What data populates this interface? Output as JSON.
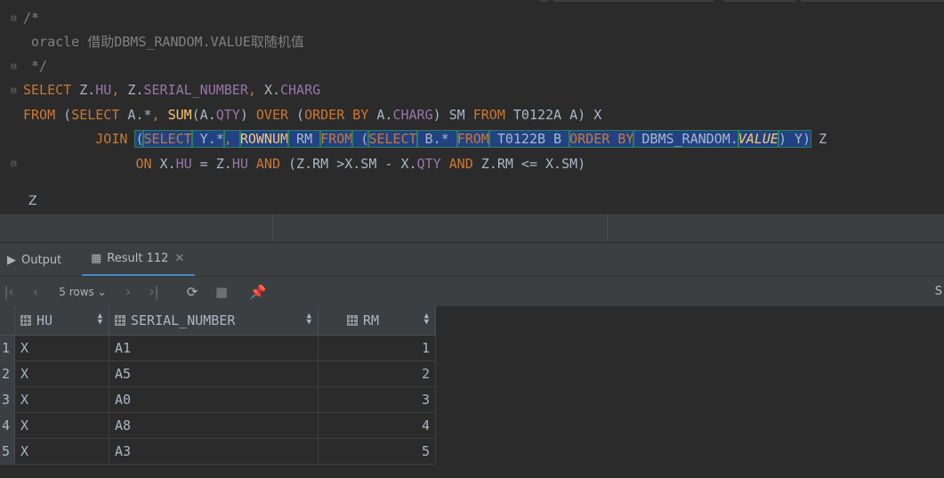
{
  "editor": {
    "lines": [
      {
        "parts": [
          {
            "t": "/*",
            "c": "cm"
          }
        ]
      },
      {
        "parts": [
          {
            "t": " oracle 借助DBMS_RANDOM.VALUE取随机值",
            "c": "cm"
          }
        ]
      },
      {
        "parts": [
          {
            "t": " */",
            "c": "cm"
          }
        ]
      },
      {
        "parts": [
          {
            "t": "SELECT",
            "c": "kw"
          },
          {
            "t": " Z.",
            "c": ""
          },
          {
            "t": "HU",
            "c": "fld"
          },
          {
            "t": ", ",
            "c": "kw"
          },
          {
            "t": "Z.",
            "c": ""
          },
          {
            "t": "SERIAL_NUMBER",
            "c": "fld"
          },
          {
            "t": ", ",
            "c": "kw"
          },
          {
            "t": "X.",
            "c": ""
          },
          {
            "t": "CHARG",
            "c": "fld"
          }
        ]
      },
      {
        "parts": [
          {
            "t": "FROM",
            "c": "kw"
          },
          {
            "t": " (",
            "c": ""
          },
          {
            "t": "SELECT",
            "c": "kw"
          },
          {
            "t": " A.*",
            "c": ""
          },
          {
            "t": ", ",
            "c": "kw"
          },
          {
            "t": "SUM",
            "c": "fn"
          },
          {
            "t": "(A.",
            "c": ""
          },
          {
            "t": "QTY",
            "c": "fld"
          },
          {
            "t": ") ",
            "c": ""
          },
          {
            "t": "OVER",
            "c": "kw"
          },
          {
            "t": " (",
            "c": ""
          },
          {
            "t": "ORDER BY",
            "c": "kw"
          },
          {
            "t": " A.",
            "c": ""
          },
          {
            "t": "CHARG",
            "c": "fld"
          },
          {
            "t": ") SM ",
            "c": ""
          },
          {
            "t": "FROM",
            "c": "kw"
          },
          {
            "t": " T0122A A) X",
            "c": ""
          }
        ]
      },
      {
        "parts": [
          {
            "t": "         ",
            "c": ""
          },
          {
            "t": "JOIN",
            "c": "kw"
          },
          {
            "t": " ",
            "c": ""
          },
          {
            "t": "(",
            "c": "sel"
          },
          {
            "t": "SELECT",
            "c": "sel kw"
          },
          {
            "t": " Y.*",
            "c": "sel"
          },
          {
            "t": ", ",
            "c": "sel kw"
          },
          {
            "t": "ROWNUM",
            "c": "sel fn"
          },
          {
            "t": " RM ",
            "c": "sel"
          },
          {
            "t": "FROM",
            "c": "sel kw"
          },
          {
            "t": " (",
            "c": "sel"
          },
          {
            "t": "SELECT",
            "c": "sel kw"
          },
          {
            "t": " B.* ",
            "c": "sel"
          },
          {
            "t": "FROM",
            "c": "sel kw"
          },
          {
            "t": " T0122B B ",
            "c": "sel"
          },
          {
            "t": "ORDER BY",
            "c": "sel kw"
          },
          {
            "t": " DBMS_RANDOM.",
            "c": "sel"
          },
          {
            "t": "VALUE",
            "c": "sel fn it"
          },
          {
            "t": ") Y)",
            "c": "sel"
          },
          {
            "t": " Z",
            "c": ""
          }
        ]
      },
      {
        "parts": [
          {
            "t": "              ",
            "c": ""
          },
          {
            "t": "ON",
            "c": "kw"
          },
          {
            "t": " X.",
            "c": ""
          },
          {
            "t": "HU",
            "c": "fld"
          },
          {
            "t": " = Z.",
            "c": ""
          },
          {
            "t": "HU",
            "c": "fld"
          },
          {
            "t": " ",
            "c": ""
          },
          {
            "t": "AND",
            "c": "kw"
          },
          {
            "t": " (Z.RM >X.SM - X.",
            "c": ""
          },
          {
            "t": "QTY",
            "c": "fld"
          },
          {
            "t": " ",
            "c": ""
          },
          {
            "t": "AND",
            "c": "kw"
          },
          {
            "t": " Z.RM <= X.SM)",
            "c": ""
          }
        ]
      }
    ]
  },
  "breadcrumb": "Z",
  "tabs": [
    {
      "label": "Output",
      "icon": "output-icon"
    },
    {
      "label": "Result 112",
      "icon": "table-icon",
      "close": "✕"
    }
  ],
  "toolbar": {
    "rows_label": "5 rows",
    "right_cut": "S"
  },
  "grid": {
    "columns": [
      "HU",
      "SERIAL_NUMBER",
      "RM"
    ],
    "rows": [
      {
        "n": "1",
        "hu": "X",
        "sn": "A1",
        "rm": "1"
      },
      {
        "n": "2",
        "hu": "X",
        "sn": "A5",
        "rm": "2"
      },
      {
        "n": "3",
        "hu": "X",
        "sn": "A0",
        "rm": "3"
      },
      {
        "n": "4",
        "hu": "X",
        "sn": "A8",
        "rm": "4"
      },
      {
        "n": "5",
        "hu": "X",
        "sn": "A3",
        "rm": "5"
      }
    ]
  }
}
